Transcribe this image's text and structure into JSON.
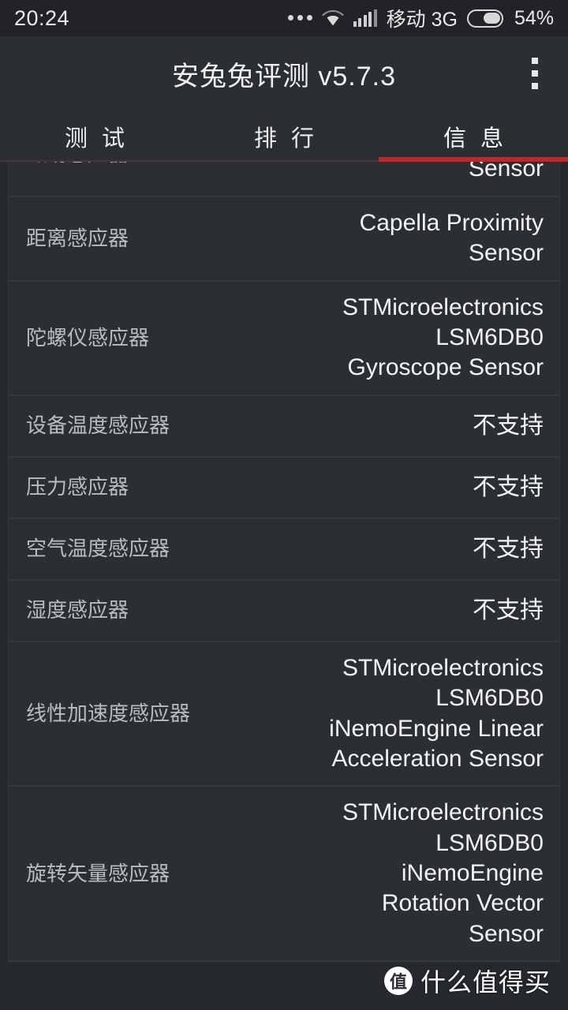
{
  "status_bar": {
    "time": "20:24",
    "more_icon": "more-dots-icon",
    "wifi_icon": "wifi-icon",
    "signal_icon": "signal-bars-icon",
    "carrier": "移动 3G",
    "battery_icon": "battery-icon",
    "battery_percent": "54%"
  },
  "title_bar": {
    "title": "安兔兔评测 v5.7.3",
    "overflow_icon": "overflow-menu-icon"
  },
  "tabs": {
    "items": [
      {
        "label": "测 试",
        "active": false
      },
      {
        "label": "排 行",
        "active": false
      },
      {
        "label": "信 息",
        "active": true
      }
    ],
    "indicator_color": "#c0272d"
  },
  "list": {
    "rows": [
      {
        "label": "磁场感应器",
        "value": "Magnetometer\nSensor",
        "clipped": true
      },
      {
        "label": "距离感应器",
        "value": "Capella Proximity\nSensor",
        "clipped": false
      },
      {
        "label": "陀螺仪感应器",
        "value": "STMicroelectronics\nLSM6DB0\nGyroscope Sensor",
        "clipped": false
      },
      {
        "label": "设备温度感应器",
        "value": "不支持",
        "clipped": false
      },
      {
        "label": "压力感应器",
        "value": "不支持",
        "clipped": false
      },
      {
        "label": "空气温度感应器",
        "value": "不支持",
        "clipped": false
      },
      {
        "label": "湿度感应器",
        "value": "不支持",
        "clipped": false
      },
      {
        "label": "线性加速度感应器",
        "value": "STMicroelectronics\nLSM6DB0\niNemoEngine Linear\nAcceleration Sensor",
        "clipped": false
      },
      {
        "label": "旋转矢量感应器",
        "value": "STMicroelectronics\nLSM6DB0\niNemoEngine\nRotation Vector\nSensor",
        "clipped": false
      }
    ]
  },
  "watermark": {
    "logo_text": "值",
    "text": "什么值得买"
  },
  "colors": {
    "page_background": "#2b2f33",
    "status_background": "#212326",
    "row_background": "#2b2e33",
    "accent_red": "#c0272d",
    "label_text": "#b9bcbf",
    "value_text": "#f4f4f4"
  }
}
